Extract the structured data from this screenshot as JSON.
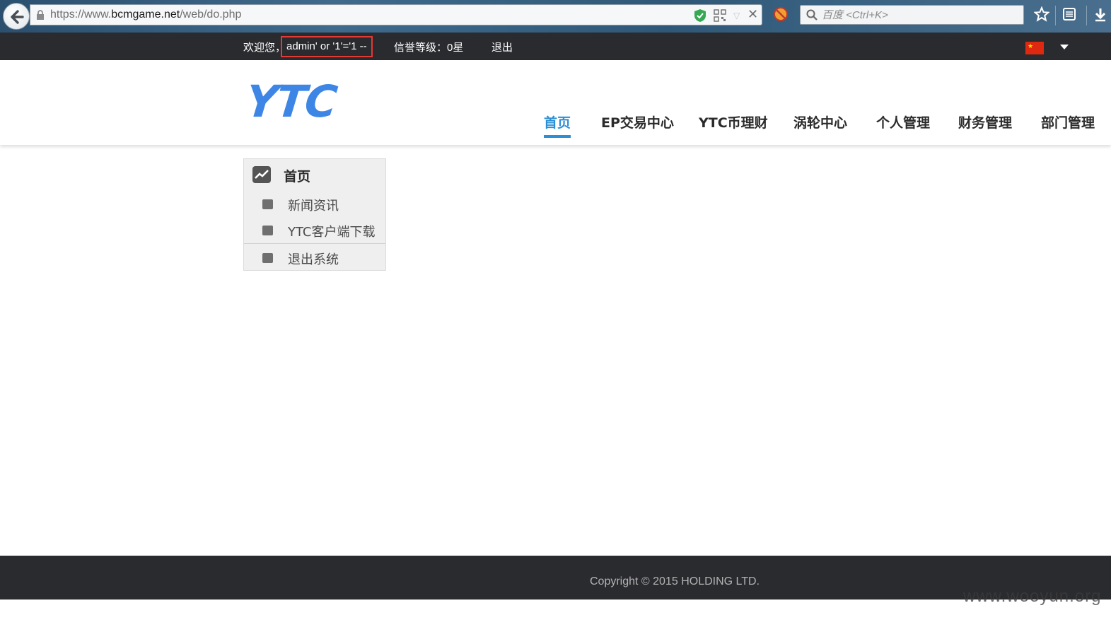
{
  "browser": {
    "url_prefix": "https://www.",
    "url_domain": "bcmgame.net",
    "url_path": "/web/do.php",
    "search_placeholder": "百度 <Ctrl+K>"
  },
  "topbar": {
    "welcome": "欢迎您，",
    "username": "admin' or '1'='1 --",
    "credit": "信誉等级：0星",
    "logout": "退出"
  },
  "header": {
    "logo": "YTC",
    "accent_color": "#2c8fd6",
    "logo_color": "#3d86e6",
    "nav": [
      {
        "label": "首页",
        "active": true
      },
      {
        "label": "EP交易中心",
        "active": false
      },
      {
        "label": "YTC币理财",
        "active": false
      },
      {
        "label": "涡轮中心",
        "active": false
      },
      {
        "label": "个人管理",
        "active": false
      },
      {
        "label": "财务管理",
        "active": false
      },
      {
        "label": "部门管理",
        "active": false
      }
    ]
  },
  "sidemenu": {
    "title": "首页",
    "items": [
      {
        "label": "新闻资讯"
      },
      {
        "label": "YTC客户端下载"
      },
      {
        "label": "退出系统"
      }
    ]
  },
  "footer": {
    "copyright": "Copyright © 2015 HOLDING LTD."
  },
  "watermark": "www.wooyun.org"
}
